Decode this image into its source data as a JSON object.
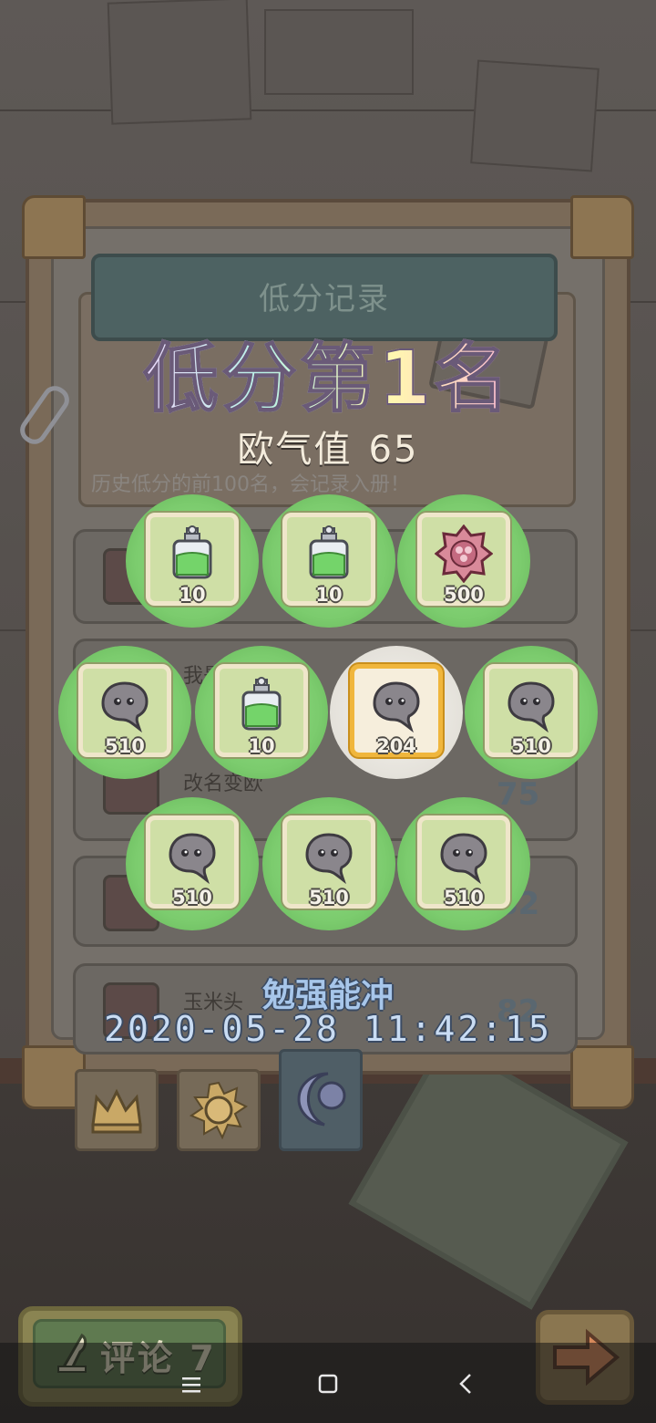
{
  "header": {
    "title": "低分记录",
    "rank_title": "低分第1名",
    "luck_label": "欧气值",
    "luck_value": "65",
    "hint": "历史低分的前100名，会记录入册！"
  },
  "list_rows": [
    {
      "name": "我是",
      "score": ""
    },
    {
      "name": "改名变欧",
      "score": "75"
    },
    {
      "name": "",
      "score": "82"
    },
    {
      "name": "玉米头",
      "score": "82"
    }
  ],
  "rewards": [
    {
      "item": "green-potion-icon",
      "qty": "10",
      "highlight": false
    },
    {
      "item": "green-potion-icon",
      "qty": "10",
      "highlight": false
    },
    {
      "item": "red-gem-icon",
      "qty": "500",
      "highlight": false
    },
    {
      "item": "ghost-bubble-icon",
      "qty": "510",
      "highlight": false
    },
    {
      "item": "green-potion-icon",
      "qty": "10",
      "highlight": false
    },
    {
      "item": "ghost-bubble-icon",
      "qty": "204",
      "highlight": true
    },
    {
      "item": "ghost-bubble-icon",
      "qty": "510",
      "highlight": false
    },
    {
      "item": "ghost-bubble-icon",
      "qty": "510",
      "highlight": false
    },
    {
      "item": "ghost-bubble-icon",
      "qty": "510",
      "highlight": false
    },
    {
      "item": "ghost-bubble-icon",
      "qty": "510",
      "highlight": false
    }
  ],
  "reward_info": {
    "name": "勉强能冲",
    "timestamp": "2020-05-28 11:42:15"
  },
  "tabs": [
    {
      "name": "crown-icon",
      "active": false
    },
    {
      "name": "sun-icon",
      "active": false
    },
    {
      "name": "moon-icon",
      "active": true
    }
  ],
  "bottom": {
    "comment_label": "评论 7"
  },
  "colors": {
    "reward_green": "#7ccc6e",
    "highlight_gold": "#f0b63c",
    "name_blue": "#a7c6ea"
  }
}
